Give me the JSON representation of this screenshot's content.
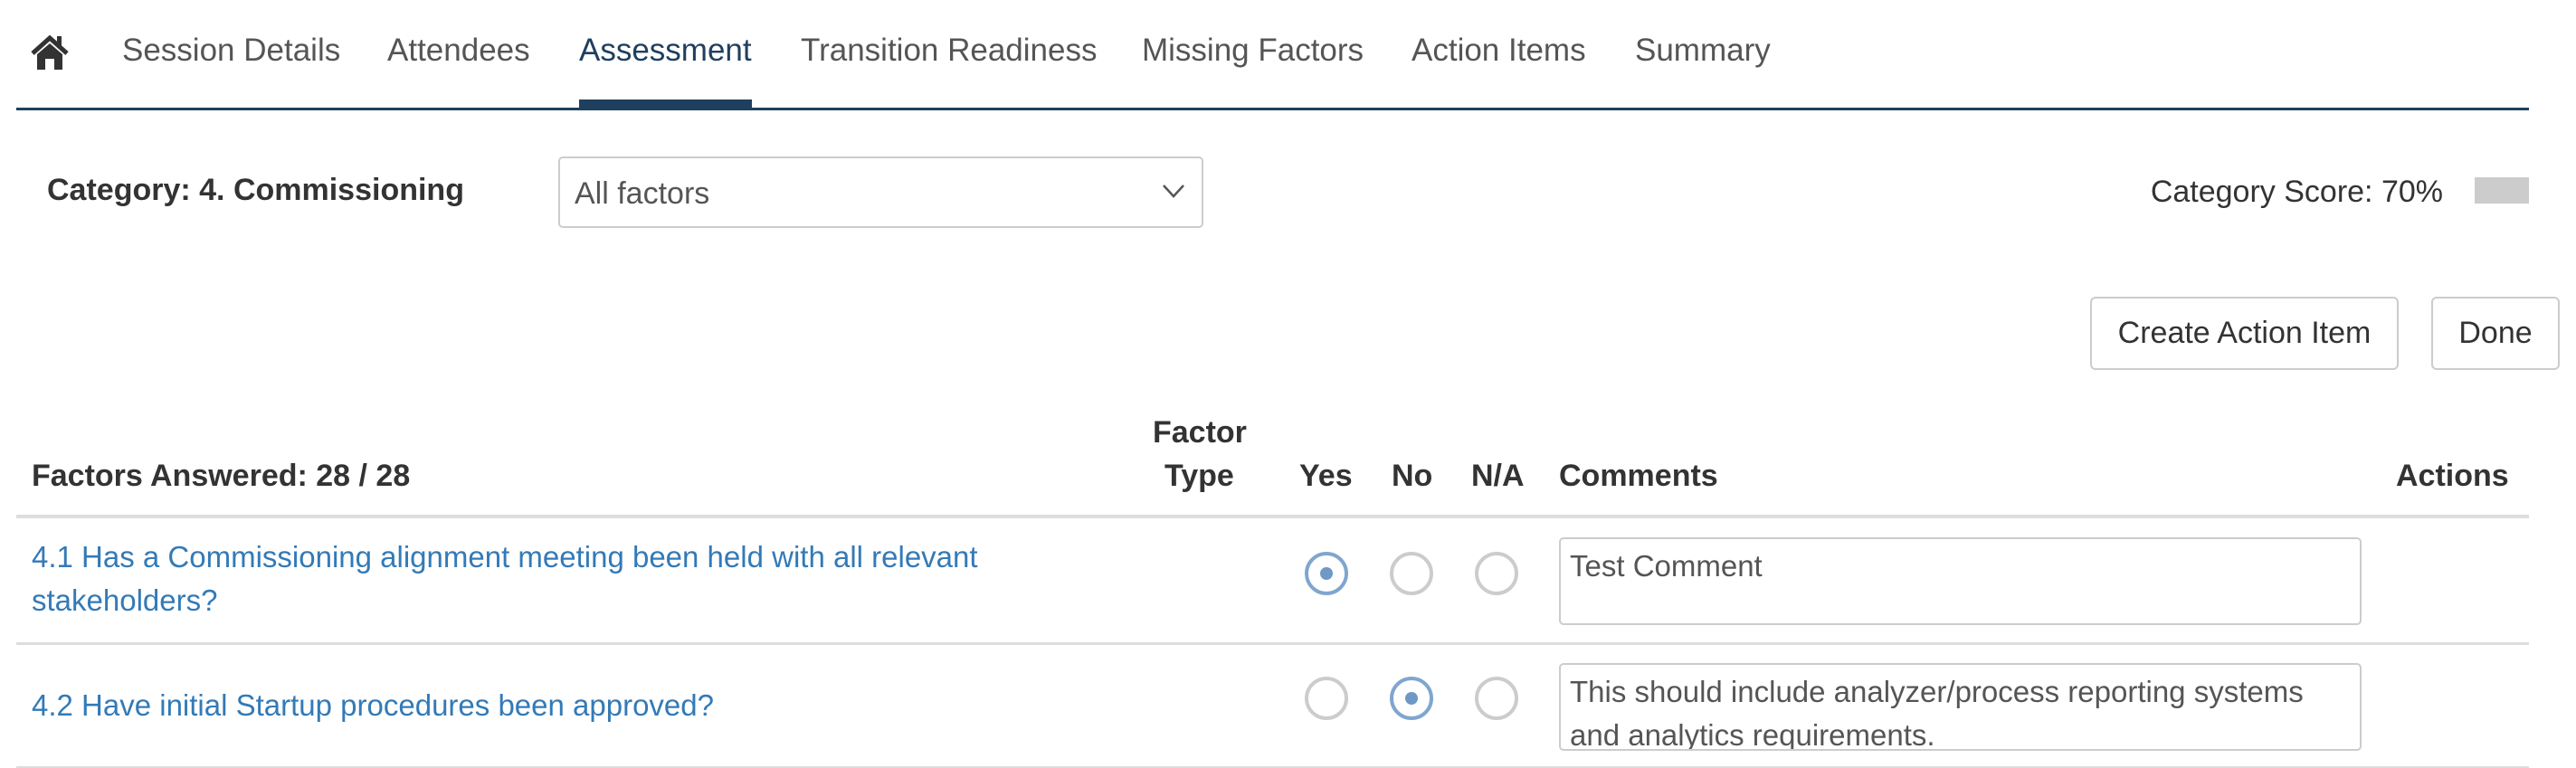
{
  "nav": {
    "home_icon": "home-icon",
    "tabs": [
      {
        "label": "Session Details",
        "active": false
      },
      {
        "label": "Attendees",
        "active": false
      },
      {
        "label": "Assessment",
        "active": true
      },
      {
        "label": "Transition Readiness",
        "active": false
      },
      {
        "label": "Missing Factors",
        "active": false
      },
      {
        "label": "Action Items",
        "active": false
      },
      {
        "label": "Summary",
        "active": false
      }
    ],
    "accent_color": "#1f3f5e"
  },
  "category": {
    "label": "Category: 4. Commissioning",
    "filter_selected": "All factors",
    "score_label": "Category Score: 70%",
    "score_percent": 70,
    "score_indicator_color": "#cccccc"
  },
  "toolbar": {
    "create_action_item_label": "Create Action Item",
    "done_label": "Done"
  },
  "table": {
    "headers": {
      "factors_answered": "Factors Answered: 28 / 28",
      "factor_type_line1": "Factor",
      "factor_type_line2": "Type",
      "yes": "Yes",
      "no": "No",
      "na": "N/A",
      "comments": "Comments",
      "actions": "Actions"
    },
    "rows": [
      {
        "question": "4.1 Has a Commissioning alignment meeting been held with all relevant stakeholders?",
        "factor_type": "",
        "answer": "yes",
        "comment": "Test Comment"
      },
      {
        "question": "4.2 Have initial Startup procedures been approved?",
        "factor_type": "",
        "answer": "no",
        "comment": "This should include analyzer/process reporting systems and analytics requirements."
      }
    ],
    "link_color": "#337ab7",
    "selected_radio_color": "#6e98c6"
  }
}
